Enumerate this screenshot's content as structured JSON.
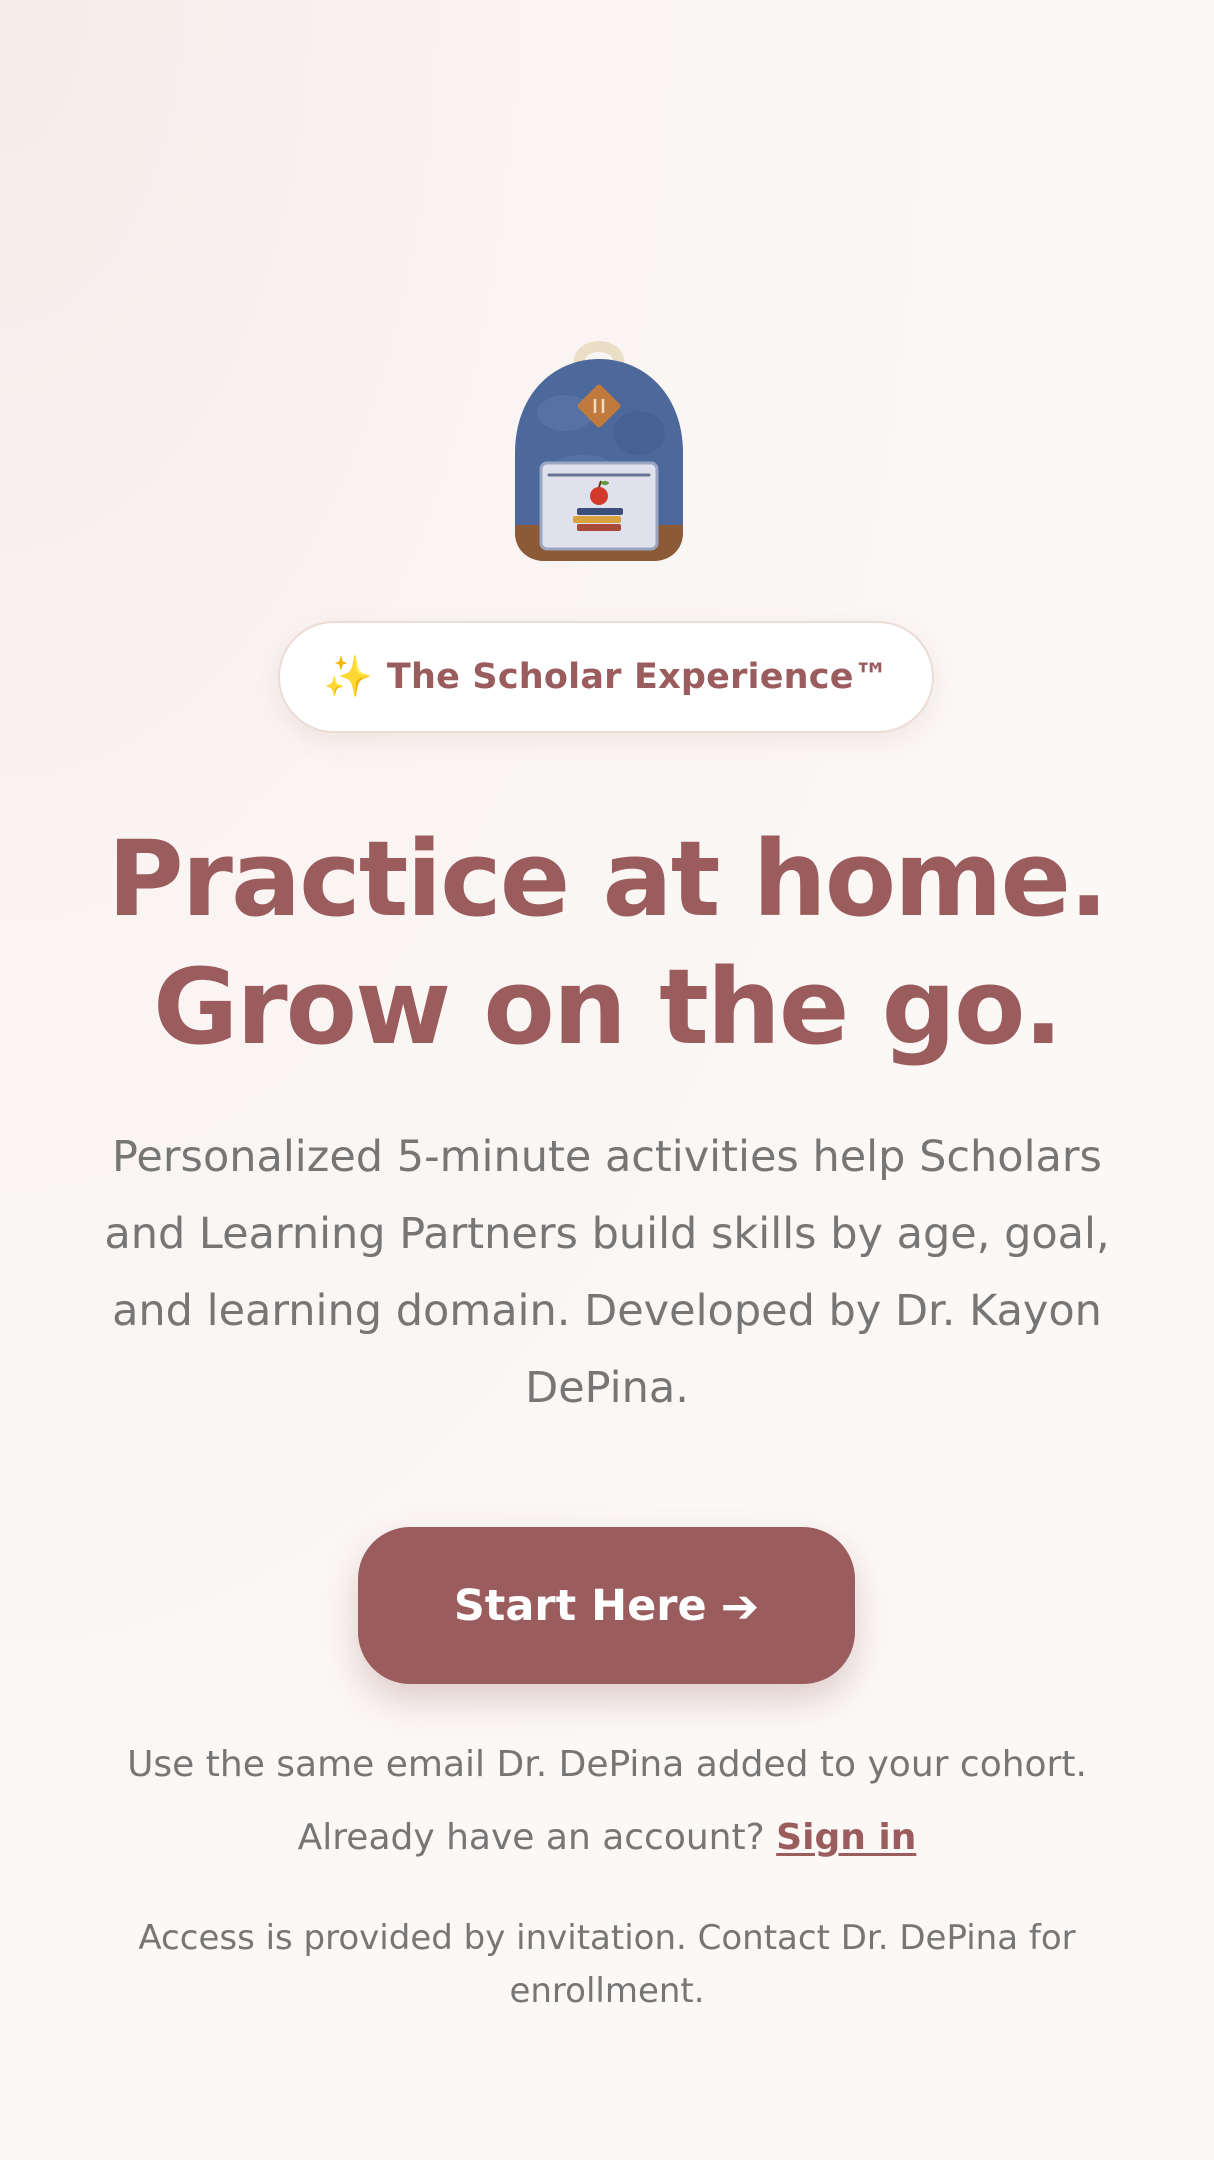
{
  "hero": {
    "illustration_icon": "backpack-icon",
    "badge": {
      "icon": "sparkles-icon",
      "icon_glyph": "✨",
      "label": "The Scholar Experience™"
    },
    "headline_line1": "Practice at home.",
    "headline_line2": "Grow on the go.",
    "description": "Personalized 5-minute activities help Scholars and Learning Partners build skills by age, goal, and learning domain. Developed by Dr. Kayon DePina."
  },
  "cta": {
    "label": "Start Here",
    "arrow_icon": "arrow-right-icon",
    "arrow_glyph": "➔"
  },
  "hint": "Use the same email Dr. DePina added to your cohort.",
  "signin": {
    "prompt": "Already have an account?",
    "link_label": "Sign in"
  },
  "access_note": "Access is provided by invitation. Contact Dr. DePina for enrollment.",
  "colors": {
    "brand": "#9b5c5e",
    "text_muted": "#767676",
    "background": "#fbf8f6",
    "badge_bg": "#ffffff"
  }
}
